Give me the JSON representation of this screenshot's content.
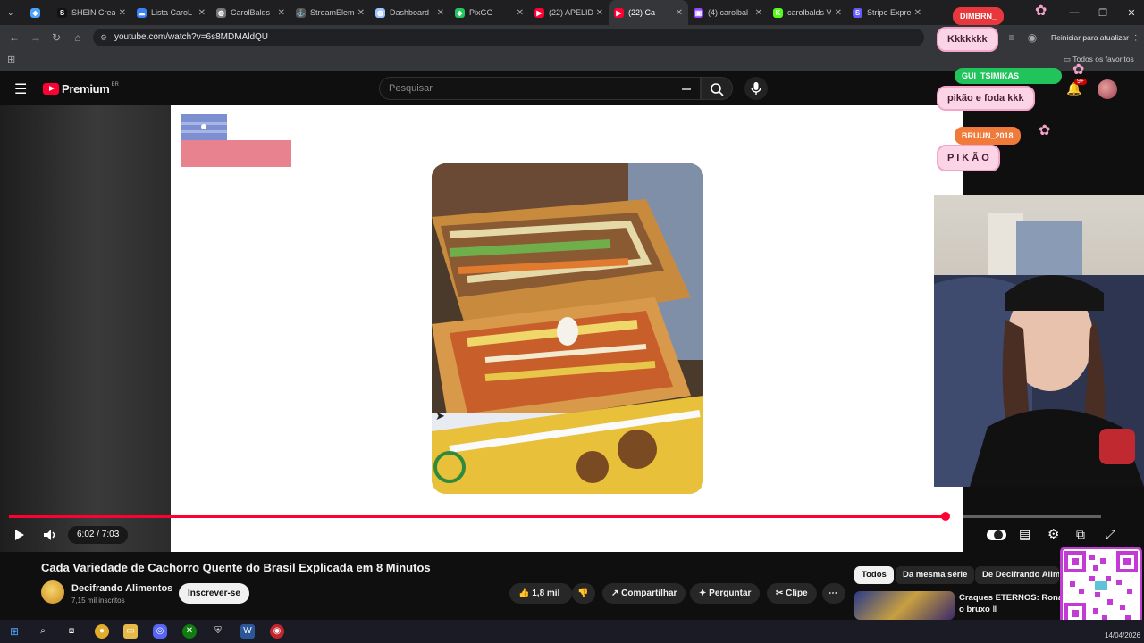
{
  "browser": {
    "tabs": [
      {
        "label": "",
        "fav": "gem",
        "color": "#4aa3ff"
      },
      {
        "label": "SHEIN Crea",
        "fav": "S",
        "color": "#111111"
      },
      {
        "label": "Lista CaroL",
        "fav": "cloud",
        "color": "#3b82f6"
      },
      {
        "label": "CarolBalds",
        "fav": "globe",
        "color": "#777777"
      },
      {
        "label": "StreamElem",
        "fav": "anchor",
        "color": "#555555"
      },
      {
        "label": "Dashboard",
        "fav": "globe",
        "color": "#a0c4ff"
      },
      {
        "label": "PixGG",
        "fav": "pix",
        "color": "#22c55e"
      },
      {
        "label": "(22) APELID",
        "fav": "yt",
        "color": "#ff0033"
      },
      {
        "label": "(22) Ca",
        "fav": "yt",
        "color": "#ff0033",
        "active": true
      },
      {
        "label": "(4) carolbal",
        "fav": "twitch",
        "color": "#9146ff"
      },
      {
        "label": "carolbalds V",
        "fav": "K",
        "color": "#53fc18"
      },
      {
        "label": "Stripe Expre",
        "fav": "stripe",
        "color": "#635bff"
      }
    ],
    "url": "youtube.com/watch?v=6s8MDMAldQU",
    "restart_label": "Reiniciar para atualizar",
    "bookmarks_label": "Todos os favoritos"
  },
  "youtube": {
    "logo_text": "Premium",
    "logo_badge": "BR",
    "search_placeholder": "Pesquisar",
    "notifications_count": "9+",
    "player": {
      "time": "6:02 / 7:03",
      "progress": 0.858
    },
    "video_title": "Cada Variedade de Cachorro Quente do Brasil Explicada em 8 Minutos",
    "channel": {
      "name": "Decifrando Alimentos",
      "subscribers": "7,15 mil inscritos"
    },
    "subscribe_label": "Inscrever-se",
    "actions": {
      "likes": "1,8 mil",
      "share": "Compartilhar",
      "ask": "Perguntar",
      "clip": "Clipe"
    },
    "chips": [
      "Todos",
      "Da mesma série",
      "De Decifrando Alim"
    ],
    "recommended": {
      "title_line1": "Craques ETERNOS: Ronald",
      "title_line2": "o bruxo ‖"
    }
  },
  "overlay": {
    "chat": [
      {
        "user": "DIMBRN_",
        "user_color": "#e8383d",
        "message": "Kkkkkkk"
      },
      {
        "user": "GUI_TSIMIKAS",
        "user_color": "#21c45a",
        "message": "pikão e foda kkk"
      },
      {
        "user": "BRUUN_2018",
        "user_color": "#f07a3a",
        "message": "P I K Ã O"
      }
    ]
  },
  "taskbar": {
    "date": "14/04/2026"
  }
}
